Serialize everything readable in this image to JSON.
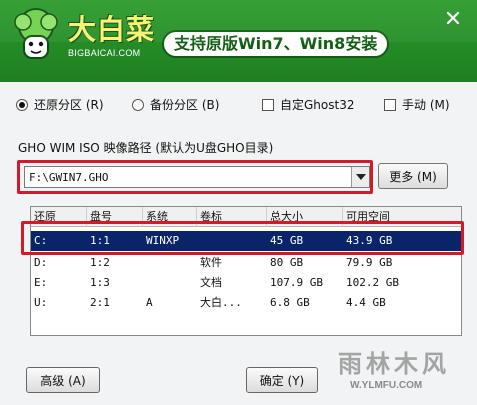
{
  "header": {
    "brand_cn": "大白菜",
    "brand_en": "BIGBAICAI.COM",
    "slogan": "支持原版Win7、Win8安装",
    "close_icon": "close-icon"
  },
  "options": {
    "restore": "还原分区 (R)",
    "backup": "备份分区 (B)",
    "custom_ghost": "自定Ghost32",
    "manual": "手动 (M)"
  },
  "path": {
    "label": "GHO WIM ISO 映像路径 (默认为U盘GHO目录)",
    "value": "F:\\GWIN7.GHO",
    "more_label": "更多 (M)"
  },
  "table": {
    "headers": [
      "还原",
      "盘号",
      "系统",
      "卷标",
      "总大小",
      "可用空间"
    ],
    "rows": [
      [
        "C:",
        "1:1",
        "WINXP",
        "",
        "45 GB",
        "43.9 GB"
      ],
      [
        "D:",
        "1:2",
        "",
        "软件",
        "80 GB",
        "79.9 GB"
      ],
      [
        "E:",
        "1:3",
        "",
        "文档",
        "107.9 GB",
        "102.2 GB"
      ],
      [
        "U:",
        "2:1",
        "A",
        "大白...",
        "6.8 GB",
        "4.4 GB"
      ]
    ]
  },
  "buttons": {
    "advanced": "高级 (A)",
    "ok": "确定 (Y)"
  },
  "watermark": {
    "text_cn": "雨林木风",
    "url": "W.YLMFU.COM"
  },
  "colors": {
    "header_green": "#1f7f22",
    "selection_blue": "#0a246a",
    "highlight_red": "#d21b2a"
  }
}
